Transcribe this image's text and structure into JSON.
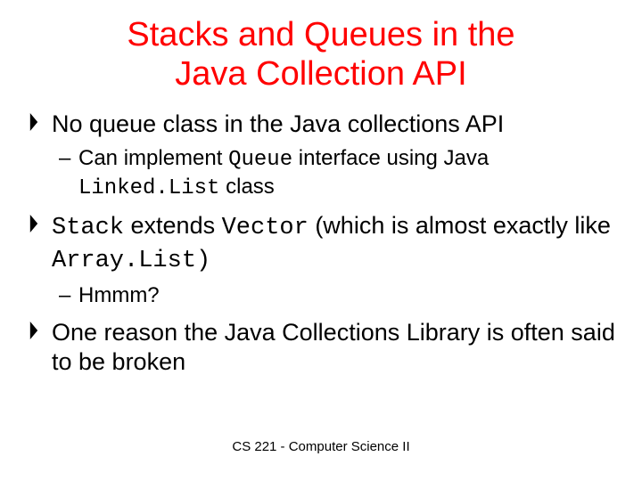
{
  "title_line1": "Stacks and Queues in the",
  "title_line2": "Java Collection API",
  "bullets": {
    "b1": {
      "text": "No queue class in the Java collections API",
      "sub": {
        "pre": "Can implement ",
        "code1": "Queue",
        "mid": " interface using Java ",
        "code2": "Linked.List",
        "post": " class"
      }
    },
    "b2": {
      "code1": "Stack",
      "t1": " extends ",
      "code2": "Vector",
      "t2": " (which is almost exactly like ",
      "code3": "Array.List)",
      "sub": "Hmmm?"
    },
    "b3": "One reason the Java Collections Library is often said to be broken"
  },
  "footer": "CS 221 - Computer Science II"
}
